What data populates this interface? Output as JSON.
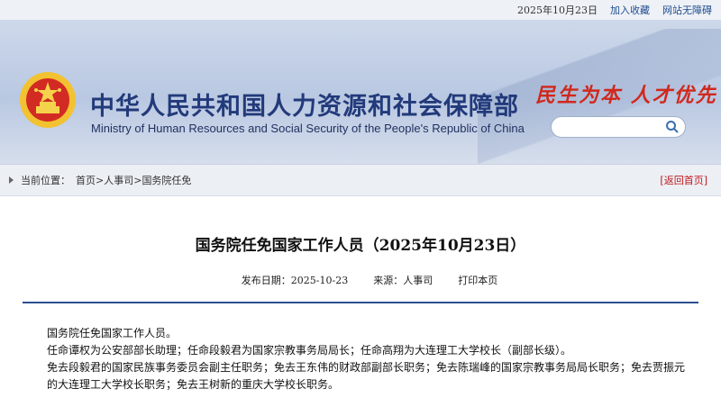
{
  "topbar": {
    "date": "2025年10月23日",
    "favorite": "加入收藏",
    "accessibility": "网站无障碍"
  },
  "header": {
    "title_cn": "中华人民共和国人力资源和社会保障部",
    "title_en": "Ministry of Human Resources and Social Security of the People's Republic of China",
    "slogan": "民生为本 人才优先",
    "search_placeholder": ""
  },
  "breadcrumb": {
    "label": "当前位置：",
    "items": [
      "首页",
      ">",
      "人事司",
      ">",
      "国务院任免"
    ],
    "home_link": "[返回首页]"
  },
  "article": {
    "title": "国务院任免国家工作人员（2025年10月23日）",
    "publish_label": "发布日期：",
    "publish_date": "2025-10-23",
    "source_label": "来源：",
    "source": "人事司",
    "print": "打印本页",
    "paragraphs": [
      "国务院任免国家工作人员。",
      "任命谭权为公安部部长助理；任命段毅君为国家宗教事务局局长；任命高翔为大连理工大学校长（副部长级）。",
      "免去段毅君的国家民族事务委员会副主任职务；免去王东伟的财政部副部长职务；免去陈瑞峰的国家宗教事务局局长职务；免去贾振元的大连理工大学校长职务；免去王树新的重庆大学校长职务。"
    ]
  },
  "colors": {
    "accent": "#2b4f8e",
    "brand_red": "#c0171c"
  }
}
